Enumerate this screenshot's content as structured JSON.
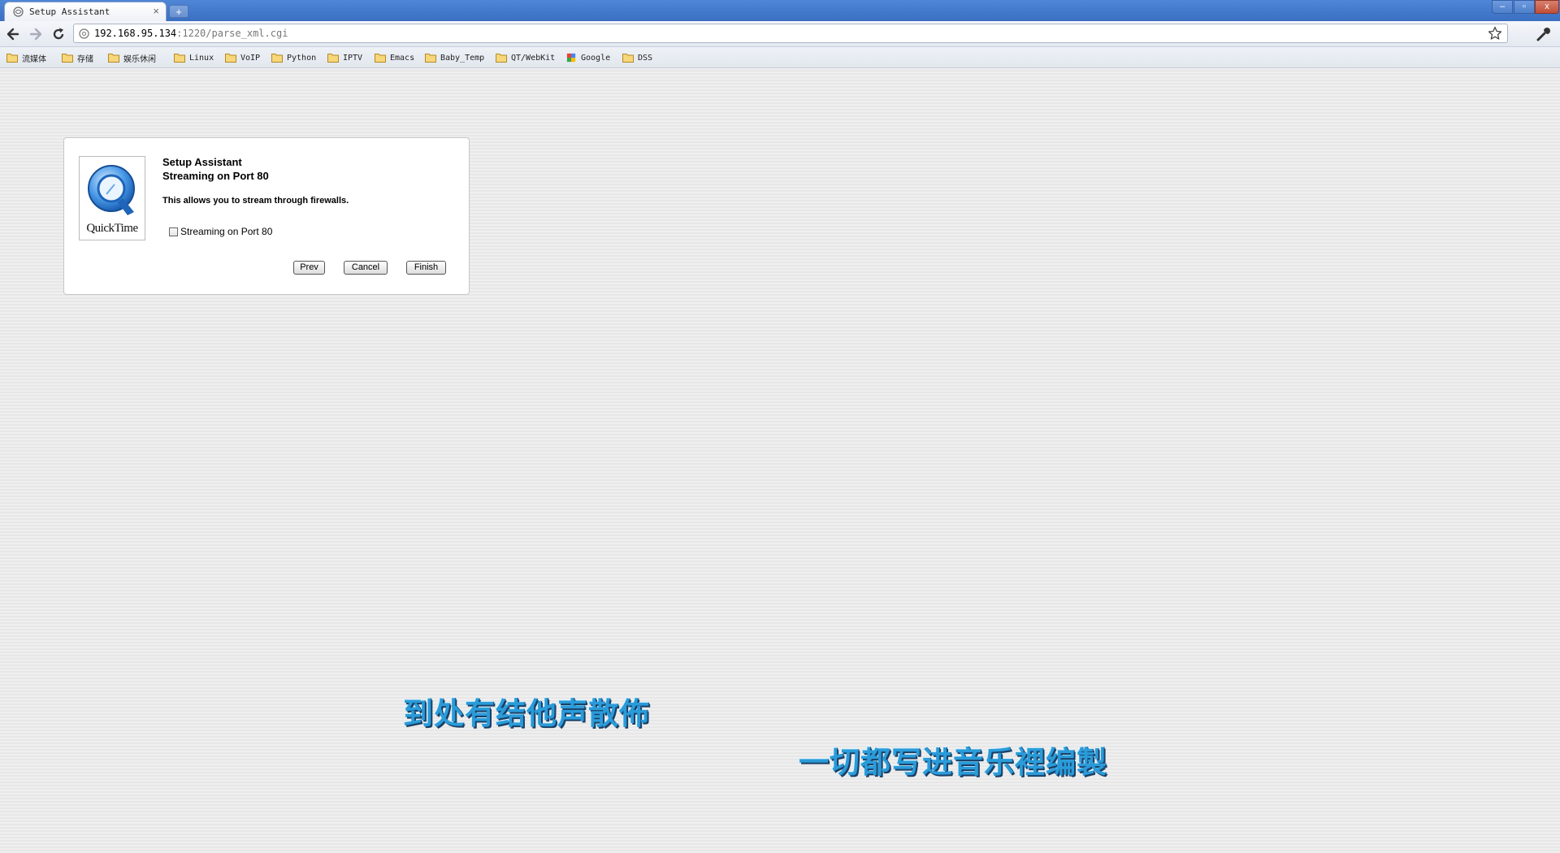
{
  "browser": {
    "tab_title": "Setup Assistant",
    "tab_close": "×",
    "new_tab": "+",
    "url_host": "192.168.95.134",
    "url_rest": ":1220/parse_xml.cgi",
    "window_controls": {
      "minimize": "–",
      "maximize": "▫",
      "close": "x"
    }
  },
  "bookmarks": [
    {
      "label": "流媒体",
      "icon": "folder-icon"
    },
    {
      "label": "存储",
      "icon": "folder-icon"
    },
    {
      "label": "娱乐休闲",
      "icon": "folder-icon"
    },
    {
      "label": "Linux",
      "icon": "folder-icon"
    },
    {
      "label": "VoIP",
      "icon": "folder-icon"
    },
    {
      "label": "Python",
      "icon": "folder-icon"
    },
    {
      "label": "IPTV",
      "icon": "folder-icon"
    },
    {
      "label": "Emacs",
      "icon": "folder-icon"
    },
    {
      "label": "Baby_Temp",
      "icon": "folder-icon"
    },
    {
      "label": "QT/WebKit",
      "icon": "folder-icon"
    },
    {
      "label": "Google",
      "icon": "google-icon"
    },
    {
      "label": "DSS",
      "icon": "folder-icon"
    }
  ],
  "dialog": {
    "logo_text": "QuickTime",
    "title": "Setup Assistant",
    "subtitle": "Streaming on Port 80",
    "description": "This allows you to stream through firewalls.",
    "checkbox_label": "Streaming on Port 80",
    "checkbox_checked": false,
    "buttons": {
      "prev": "Prev",
      "cancel": "Cancel",
      "finish": "Finish"
    }
  },
  "subtitles": {
    "line1": "到处有结他声散佈",
    "line2": "一切都写进音乐裡编製"
  },
  "colors": {
    "titlebar": "#3a6fc1",
    "subtitle_text": "#2a9bd9",
    "dialog_bg": "#ffffff",
    "page_bg": "#ececec"
  }
}
